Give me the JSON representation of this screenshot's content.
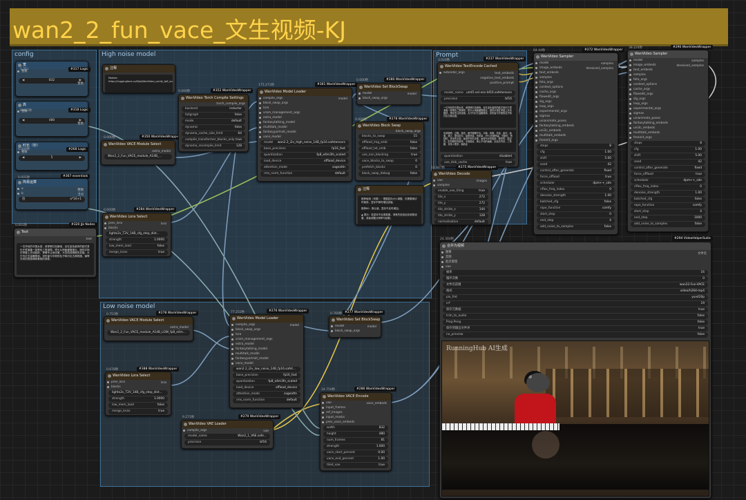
{
  "title": "wan2_2_fun_vace_文生视频-KJ",
  "groups": {
    "config": "config",
    "high": "High noise model",
    "low": "Low noise model",
    "prompt": "Prompt"
  },
  "nodes": {
    "logic1": {
      "badge": "#317 Logic",
      "time": "1.31s",
      "title": "宽",
      "label": "整数",
      "out": "整数",
      "value": "832"
    },
    "logic2": {
      "badge": "#318 Logic",
      "time": "0.001秒",
      "title": "高",
      "label": "整数",
      "out": "整数",
      "value": "480"
    },
    "logic3": {
      "badge": "#268 Logic",
      "time": "0.000秒",
      "title": "时长（秒）",
      "label": "整数",
      "value": "5"
    },
    "essentials": {
      "badge": "#367 essentials",
      "time": "0.001秒",
      "title": "简易运算",
      "a": "a",
      "b": "b",
      "out1": "整数",
      "out2": "浮点",
      "expr": "a*16+1"
    },
    "text": {
      "badge": "#320 Jjk Nodes",
      "time": "0.001秒",
      "title": "Text",
      "out": "text",
      "body": "一位年轻的中国女孩，身穿鲜红色旗袍，坐在金色装饰的欧式音乐厅里演奏一架黑色三角钢琴。镜头从侧面缓慢推近，她的手指在琴键上灵动跳跃，神情专注而优雅，头发梳成精致的发髻。大厅内灯光温暖柔和，拱形窗与华丽的柱子映衬出古典氛围，钢琴光亮的表面倒映着她的身影。"
    },
    "note1": {
      "title": "注释",
      "body": "Models:\nhttps://huggingface.co/Kijai/WanVideo_comfy_fp8_scaled/tree/main/Fun"
    },
    "vace_hi": {
      "badge": "#350 WanVideoWrapper",
      "time": "0.000秒",
      "title": "WanVideo VACE Module Select",
      "out": "extra_model",
      "value": "Wan2_2_Fun_VACE_module_A14B_..."
    },
    "torch": {
      "badge": "#352 WanVideoWrapper",
      "time": "0.000秒",
      "title": "WanVideo Torch Compile Settings",
      "out": "torch_compile_args",
      "rows": [
        [
          "backend",
          "inductor"
        ],
        [
          "fullgraph",
          "false"
        ],
        [
          "mode",
          "default"
        ],
        [
          "dynamic",
          "false"
        ],
        [
          "dynamo_cache_size_limit",
          "64"
        ],
        [
          "compile_transformer_blocks_only",
          "true"
        ],
        [
          "dynamo_recompile_limit",
          "128"
        ]
      ]
    },
    "loader_hi": {
      "badge": "#361 WanVideoWrapper",
      "time": "175.271秒",
      "title": "WanVideo Model Loader",
      "out": "model",
      "ports": [
        "compile_args",
        "block_swap_args",
        "lora",
        "vram_management_args",
        "extra_model",
        "fantasytalking_model",
        "multitalk_model",
        "fantasyportrait_model",
        "vace_model"
      ],
      "rows": [
        [
          "model",
          "wan2.2_i2v_high_noise_14B_fp16.safetensors"
        ],
        [
          "base_precision",
          "fp16_fast"
        ],
        [
          "quantization",
          "fp8_e4m3fn_scaled"
        ],
        [
          "load_device",
          "offload_device"
        ],
        [
          "attention_mode",
          "sageattn"
        ],
        [
          "rms_norm_function",
          "default"
        ]
      ]
    },
    "blockswap_set_hi": {
      "badge": "#280 WanVideoWrapper",
      "time": "0.000秒",
      "title": "WanVideo Set BlockSwap",
      "in1": "model",
      "in2": "block_swap_args",
      "out": "model"
    },
    "blockswap": {
      "badge": "#278 WanVideoWrapper",
      "time": "0.000秒",
      "title": "WanVideo Block Swap",
      "out": "block_swap_args",
      "rows": [
        [
          "blocks_to_swap",
          "15"
        ],
        [
          "offload_img_emb",
          "false"
        ],
        [
          "offload_txt_emb",
          "false"
        ],
        [
          "use_non_blocking",
          "true"
        ],
        [
          "vace_blocks_to_swap",
          "0"
        ],
        [
          "prefetch_blocks",
          "0"
        ],
        [
          "block_swap_debug",
          "false"
        ]
      ]
    },
    "lora_hi": {
      "badge": "#284 WanVideoWrapper",
      "time": "0.000秒",
      "title": "WanVideo Lora Select",
      "in1": "prev_lora",
      "in2": "blocks",
      "out": "lora",
      "rows": [
        [
          "lora",
          "lightx2v_T2V_14B_cfg_step_dist..."
        ],
        [
          "strength",
          "1.0000"
        ],
        [
          "low_mem_load",
          "false"
        ],
        [
          "merge_loras",
          "true"
        ]
      ]
    },
    "textenc": {
      "badge": "#237 WanVideoWrapper",
      "time": "3.024秒",
      "title": "WanVideo TextEncode Cached",
      "in1": "extender_args",
      "outs": [
        "text_embeds",
        "negative_text_embeds",
        "positive_prompt"
      ],
      "rows": [
        [
          "model_name",
          "umt5-xxl-enc-bf16.safetensors"
        ],
        [
          "precision",
          "bf16"
        ]
      ],
      "pos": "一位年轻的中国女孩，身穿鲜红色旗袍，坐在金色装饰的欧式音乐厅里演奏一架黑色三角钢琴。镜头从侧面缓慢推近，她的手指在琴键上灵动跳跃，神情专注而优雅。大厅内灯光温暖柔和，拱形窗与华丽的柱子映衬出古典氛围。",
      "neg": "色调艳丽，过曝，静态，细节模糊不清，字幕，风格，作品，画作，画面，静止，整体发灰，最差质量，低质量，JPEG压缩残留，丑陋的，残缺的，多余的手指，画得不好的手部，画得不好的脸部，畸形的，毁容的，形态畸形的肢体，手指融合，静止不动的画面，杂乱的背景，三条腿，背景人很多，倒着走",
      "rows2": [
        [
          "quantization",
          "disabled"
        ],
        [
          "use_disk_cache",
          "true"
        ],
        [
          "device",
          "gpu"
        ]
      ]
    },
    "note2": {
      "title": "注释",
      "body": "推荐使用（块数）：根据显存大小调整。仅需要调试时使用，显存不够时增加该值。\n\n推荐80：默认值，显存不足时增加。\n\n▲ 提示：若显存不足或报错，请首先检查此处参数设置，或者调整分辨率与帧数。"
    },
    "sampler1": {
      "badge": "#272 WanVideoWrapper",
      "time": "64.44秒",
      "title": "WanVideo Sampler",
      "ports": [
        "model",
        "image_embeds",
        "text_embeds",
        "samples",
        "feta_args",
        "context_options",
        "cache_args",
        "flowedit_args",
        "slg_args",
        "loop_args",
        "experimental_args",
        "sigmas",
        "unianimate_poses",
        "fantasytalking_embeds",
        "uni3c_embeds",
        "multitalk_embeds",
        "freeinit_args"
      ],
      "outs": [
        "samples",
        "denoised_samples"
      ],
      "rows": [
        [
          "steps",
          "8"
        ],
        [
          "cfg",
          "1.00"
        ],
        [
          "shift",
          "5.00"
        ],
        [
          "seed",
          "42"
        ],
        [
          "control_after_generate",
          "fixed"
        ],
        [
          "force_offload",
          "true"
        ],
        [
          "scheduler",
          "dpm++_sde"
        ],
        [
          "riflex_freq_index",
          "0"
        ],
        [
          "denoise_strength",
          "1.00"
        ],
        [
          "batched_cfg",
          "false"
        ],
        [
          "rope_function",
          "comfy"
        ],
        [
          "start_step",
          "0"
        ],
        [
          "end_step",
          "4"
        ],
        [
          "add_noise_to_samples",
          "false"
        ]
      ]
    },
    "sampler2": {
      "badge": "#290 WanVideoWrapper",
      "time": "38.224秒",
      "title": "WanVideo Sampler",
      "ports": [
        "model",
        "image_embeds",
        "text_embeds",
        "samples",
        "feta_args",
        "context_options",
        "cache_args",
        "flowedit_args",
        "slg_args",
        "loop_args",
        "experimental_args",
        "sigmas",
        "unianimate_poses",
        "fantasytalking_embeds",
        "uni3c_embeds",
        "multitalk_embeds",
        "freeinit_args"
      ],
      "outs": [
        "samples",
        "denoised_samples"
      ],
      "rows": [
        [
          "steps",
          "8"
        ],
        [
          "cfg",
          "1.00"
        ],
        [
          "shift",
          "5.00"
        ],
        [
          "seed",
          "42"
        ],
        [
          "control_after_generate",
          "fixed"
        ],
        [
          "force_offload",
          "true"
        ],
        [
          "scheduler",
          "dpm++_sde"
        ],
        [
          "riflex_freq_index",
          "0"
        ],
        [
          "denoise_strength",
          "1.00"
        ],
        [
          "batched_cfg",
          "false"
        ],
        [
          "rope_function",
          "comfy"
        ],
        [
          "start_step",
          "4"
        ],
        [
          "end_step",
          "1000"
        ],
        [
          "add_noise_to_samples",
          "false"
        ]
      ]
    },
    "decode": {
      "badge": "#275 WanVideoWrapper",
      "time": "11.047秒",
      "title": "WanVideo Decode",
      "in1": "vae",
      "in2": "samples",
      "out": "images",
      "rows": [
        [
          "enable_vae_tiling",
          "true"
        ],
        [
          "tile_x",
          "272"
        ],
        [
          "tile_y",
          "272"
        ],
        [
          "tile_stride_x",
          "144"
        ],
        [
          "tile_stride_y",
          "128"
        ],
        [
          "normalization",
          "default"
        ]
      ]
    },
    "combine": {
      "badge": "#294 VideoHelperSuite",
      "time": "24.304秒",
      "title": "合并为视频",
      "ports": [
        "图像",
        "音频",
        "批次管理",
        "vae"
      ],
      "out": "文件名",
      "rows": [
        [
          "帧率",
          "16"
        ],
        [
          "循环次数",
          "0"
        ],
        [
          "文件名前缀",
          "wan22-Fun-VACE"
        ],
        [
          "格式",
          "video/h264-mp4"
        ],
        [
          "pix_fmt",
          "yuv420p"
        ],
        [
          "crf",
          "19"
        ],
        [
          "保存元数据",
          "true"
        ],
        [
          "trim_to_audio",
          "false"
        ],
        [
          "Ping-Pong",
          "false"
        ],
        [
          "保存到输出文件夹",
          "true"
        ],
        [
          "no_preview",
          "false"
        ]
      ],
      "watermark": "RunningHub AI生成"
    },
    "vace_lo": {
      "badge": "#278 WanVideoWrapper",
      "time": "0.753秒",
      "title": "WanVideo VACE Module Select",
      "out": "extra_model",
      "value": "Wan2_2_Fun_VACE_module_A14B_LOW_fp8_e4m3fn_scale..."
    },
    "loader_lo": {
      "badge": "#276 WanVideoWrapper",
      "time": "77.252秒",
      "title": "WanVideo Model Loader",
      "out": "model",
      "ports": [
        "compile_args",
        "block_swap_args",
        "lora",
        "vram_management_args",
        "extra_model",
        "fantasytalking_model",
        "multitalk_model",
        "fantasyportrait_model",
        "vace_model"
      ],
      "rows": [
        [
          "model",
          "wan2.2_i2v_low_noise_14B_fp16.safet..."
        ],
        [
          "base_precision",
          "fp16_fast"
        ],
        [
          "quantization",
          "fp8_e4m3fn_scaled"
        ],
        [
          "load_device",
          "offload_device"
        ],
        [
          "attention_mode",
          "sageattn"
        ],
        [
          "rms_norm_function",
          "default"
        ]
      ]
    },
    "blockswap_set_lo": {
      "badge": "#277 WanVideoWrapper",
      "time": "0.769秒",
      "title": "WanVideo Set BlockSwap",
      "in1": "model",
      "in2": "block_swap_args",
      "out": "model"
    },
    "lora_lo": {
      "badge": "#388 WanVideoWrapper",
      "time": "0.678秒",
      "title": "WanVideo Lora Select",
      "in1": "prev_lora",
      "in2": "blocks",
      "out": "lora",
      "rows": [
        [
          "lora",
          "lightx2v_T2V_14B_cfg_step_dist..."
        ],
        [
          "strength",
          "1.0000"
        ],
        [
          "low_mem_load",
          "false"
        ],
        [
          "merge_loras",
          "true"
        ]
      ]
    },
    "vae": {
      "badge": "#279 WanVideoWrapper",
      "time": "9.271秒",
      "title": "WanVideo VAE Loader",
      "in1": "compile_args",
      "out": "vae",
      "rows": [
        [
          "model_name",
          "Wan2_1_VAE.safe..."
        ],
        [
          "precision",
          "bf16"
        ]
      ]
    },
    "vace_enc": {
      "badge": "#286 WanVideoWrapper",
      "time": "24.750秒",
      "title": "WanVideo VACE Encode",
      "out": "vace_embeds",
      "ports": [
        "vae",
        "input_frames",
        "ref_images",
        "input_masks",
        "prev_vace_embeds"
      ],
      "rows": [
        [
          "width",
          "832"
        ],
        [
          "height",
          "480"
        ],
        [
          "num_frames",
          "81"
        ],
        [
          "strength",
          "1.000"
        ],
        [
          "vace_start_percent",
          "0.00"
        ],
        [
          "vace_end_percent",
          "1.00"
        ],
        [
          "tiled_vae",
          "true"
        ]
      ]
    }
  }
}
